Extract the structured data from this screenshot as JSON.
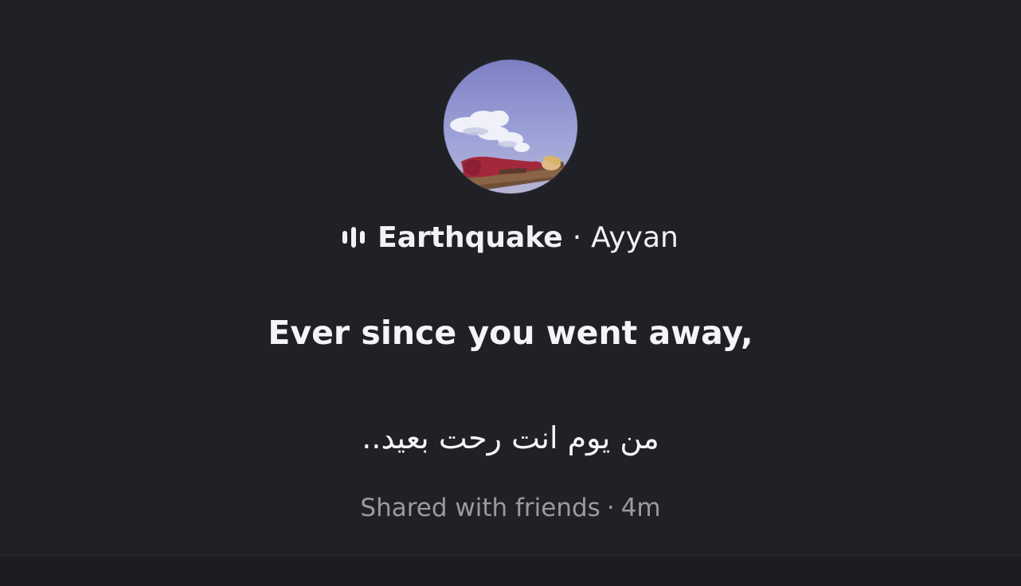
{
  "note": {
    "avatar_icon": "avatar-photo",
    "song_icon": "sound-wave-icon",
    "song_title": "Earthquake",
    "separator": "·",
    "artist": "Ayyan",
    "lyric_english": "Ever since you went away,",
    "lyric_arabic": "من يوم انت رحت بعيد..",
    "audience": "Shared with friends",
    "meta_separator": "·",
    "time_ago": "4m"
  },
  "colors": {
    "background": "#202126",
    "text_primary": "#f2f2f4",
    "text_secondary": "#9a9ba1"
  }
}
